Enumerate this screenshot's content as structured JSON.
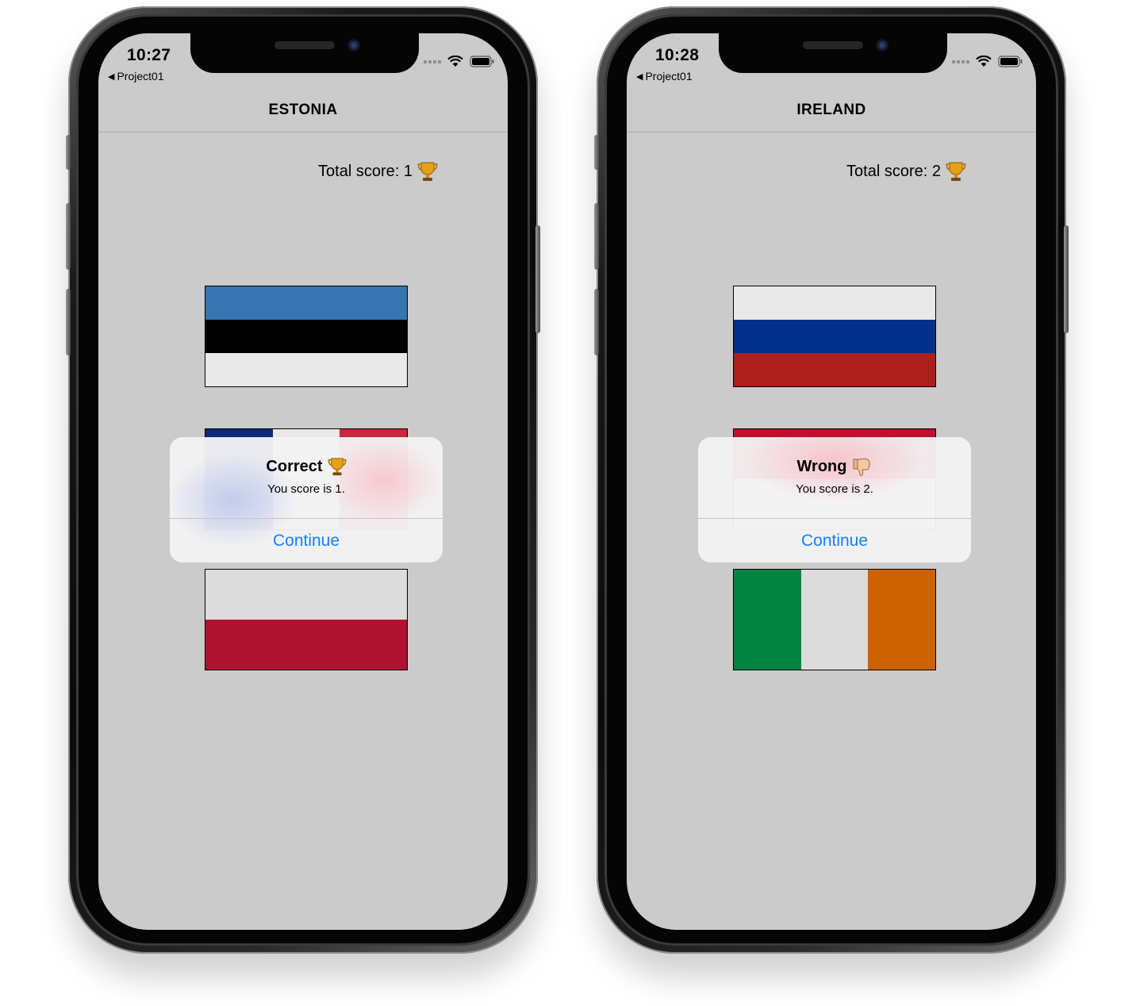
{
  "phones": [
    {
      "status_bar": {
        "time": "10:27",
        "back_label": "Project01"
      },
      "nav_title": "ESTONIA",
      "score_label": "Total score: 1",
      "score_icon": "trophy-icon",
      "flags": [
        {
          "country": "estonia",
          "orientation": "horizontal",
          "colors": [
            "#3674b2",
            "#000000",
            "#e9e9e9"
          ]
        },
        {
          "country": "france",
          "orientation": "vertical",
          "colors": [
            "#0a2a7a",
            "#e9e9e9",
            "#c8283a"
          ]
        },
        {
          "country": "poland",
          "orientation": "horizontal",
          "colors": [
            "#dcdcdc",
            "#ae1230"
          ]
        }
      ],
      "alert": {
        "title": "Correct",
        "title_icon": "trophy-icon",
        "message": "You score is 1.",
        "button": "Continue"
      }
    },
    {
      "status_bar": {
        "time": "10:28",
        "back_label": "Project01"
      },
      "nav_title": "IRELAND",
      "score_label": "Total score: 2",
      "score_icon": "trophy-icon",
      "flags": [
        {
          "country": "russia",
          "orientation": "horizontal",
          "colors": [
            "#e9e9e9",
            "#00308a",
            "#ad1f1b"
          ]
        },
        {
          "country": "monaco",
          "orientation": "horizontal",
          "colors": [
            "#c0102e",
            "#e9e9e9"
          ]
        },
        {
          "country": "ireland",
          "orientation": "vertical",
          "colors": [
            "#00843f",
            "#dcdcdc",
            "#cc6200"
          ]
        }
      ],
      "alert": {
        "title": "Wrong",
        "title_icon": "thumbs-down-icon",
        "message": "You score is 2.",
        "button": "Continue"
      }
    }
  ],
  "colors": {
    "screen_background": "#cbcbcb",
    "alert_button": "#147efb"
  }
}
